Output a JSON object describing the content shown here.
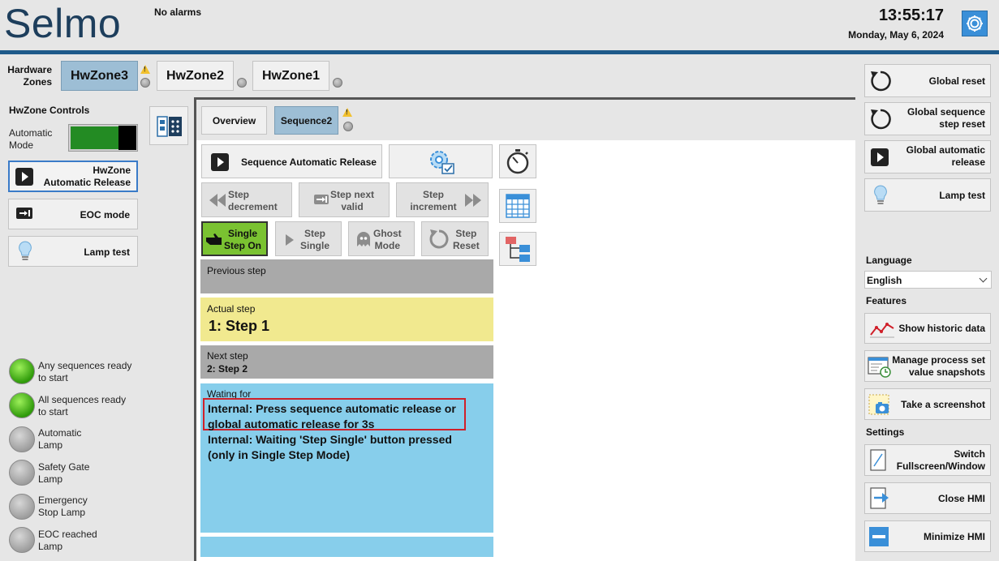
{
  "header": {
    "logo": "Selmo",
    "alarm_status": "No alarms",
    "time": "13:55:17",
    "date": "Monday, May 6, 2024",
    "settings_icon": "gear-icon"
  },
  "zones": {
    "label_line1": "Hardware",
    "label_line2": "Zones",
    "tabs": [
      {
        "label": "HwZone3"
      },
      {
        "label": "HwZone2"
      },
      {
        "label": "HwZone1"
      }
    ]
  },
  "hwzone_controls": {
    "title": "HwZone Controls",
    "automatic_mode_line1": "Automatic",
    "automatic_mode_line2": "Mode",
    "automatic_release_line1": "HwZone",
    "automatic_release_line2": "Automatic Release",
    "eoc_mode": "EOC mode",
    "lamp_test": "Lamp test"
  },
  "status_lamps": [
    {
      "line1": "Any sequences ready",
      "line2": "to start",
      "state": "green"
    },
    {
      "line1": "All sequences ready",
      "line2": "to start",
      "state": "green"
    },
    {
      "line1": "Automatic",
      "line2": "Lamp",
      "state": "grey"
    },
    {
      "line1": "Safety Gate",
      "line2": "Lamp",
      "state": "grey"
    },
    {
      "line1": "Emergency",
      "line2": "Stop Lamp",
      "state": "grey"
    },
    {
      "line1": "EOC reached",
      "line2": "Lamp",
      "state": "grey"
    }
  ],
  "sequence_tabs": {
    "overview": "Overview",
    "sequence2": "Sequence2"
  },
  "sequence_controls": {
    "automatic_release": "Sequence Automatic Release",
    "step_decrement_line1": "Step",
    "step_decrement_line2": "decrement",
    "step_next_valid_line1": "Step next",
    "step_next_valid_line2": "valid",
    "step_increment_line1": "Step",
    "step_increment_line2": "increment",
    "single_step_on_line1": "Single",
    "single_step_on_line2": "Step On",
    "step_single_line1": "Step",
    "step_single_line2": "Single",
    "ghost_mode_line1": "Ghost",
    "ghost_mode_line2": "Mode",
    "step_reset_line1": "Step",
    "step_reset_line2": "Reset"
  },
  "steps": {
    "previous_label": "Previous step",
    "actual_label": "Actual step",
    "actual_value": "1: Step 1",
    "next_label": "Next step",
    "next_value": "2: Step 2",
    "waiting_label": "Wating for",
    "waiting_line1": "Internal: Press sequence automatic release or",
    "waiting_line2": "global automatic release for 3s",
    "waiting_line3": "Internal: Waiting 'Step Single' button pressed",
    "waiting_line4": "(only in Single Step Mode)"
  },
  "right_panel": {
    "global_reset": "Global reset",
    "global_seq_reset_line1": "Global sequence",
    "global_seq_reset_line2": "step reset",
    "global_auto_release_line1": "Global automatic",
    "global_auto_release_line2": "release",
    "lamp_test": "Lamp test",
    "language_title": "Language",
    "language_value": "English",
    "features_title": "Features",
    "show_historic": "Show historic data",
    "manage_snap_line1": "Manage process set",
    "manage_snap_line2": "value snapshots",
    "screenshot": "Take a screenshot",
    "settings_title": "Settings",
    "switch_line1": "Switch",
    "switch_line2": "Fullscreen/Window",
    "close_hmi": "Close HMI",
    "minimize_hmi": "Minimize HMI"
  },
  "colors": {
    "brand_blue": "#1e5a8a",
    "active_tab": "#9dbed5",
    "actual_step_bg": "#f1e98f",
    "waiting_bg": "#87ceeb",
    "step_gray": "#a9a9a9",
    "single_step_green": "#7ac231",
    "highlight_red": "#d0202a"
  }
}
